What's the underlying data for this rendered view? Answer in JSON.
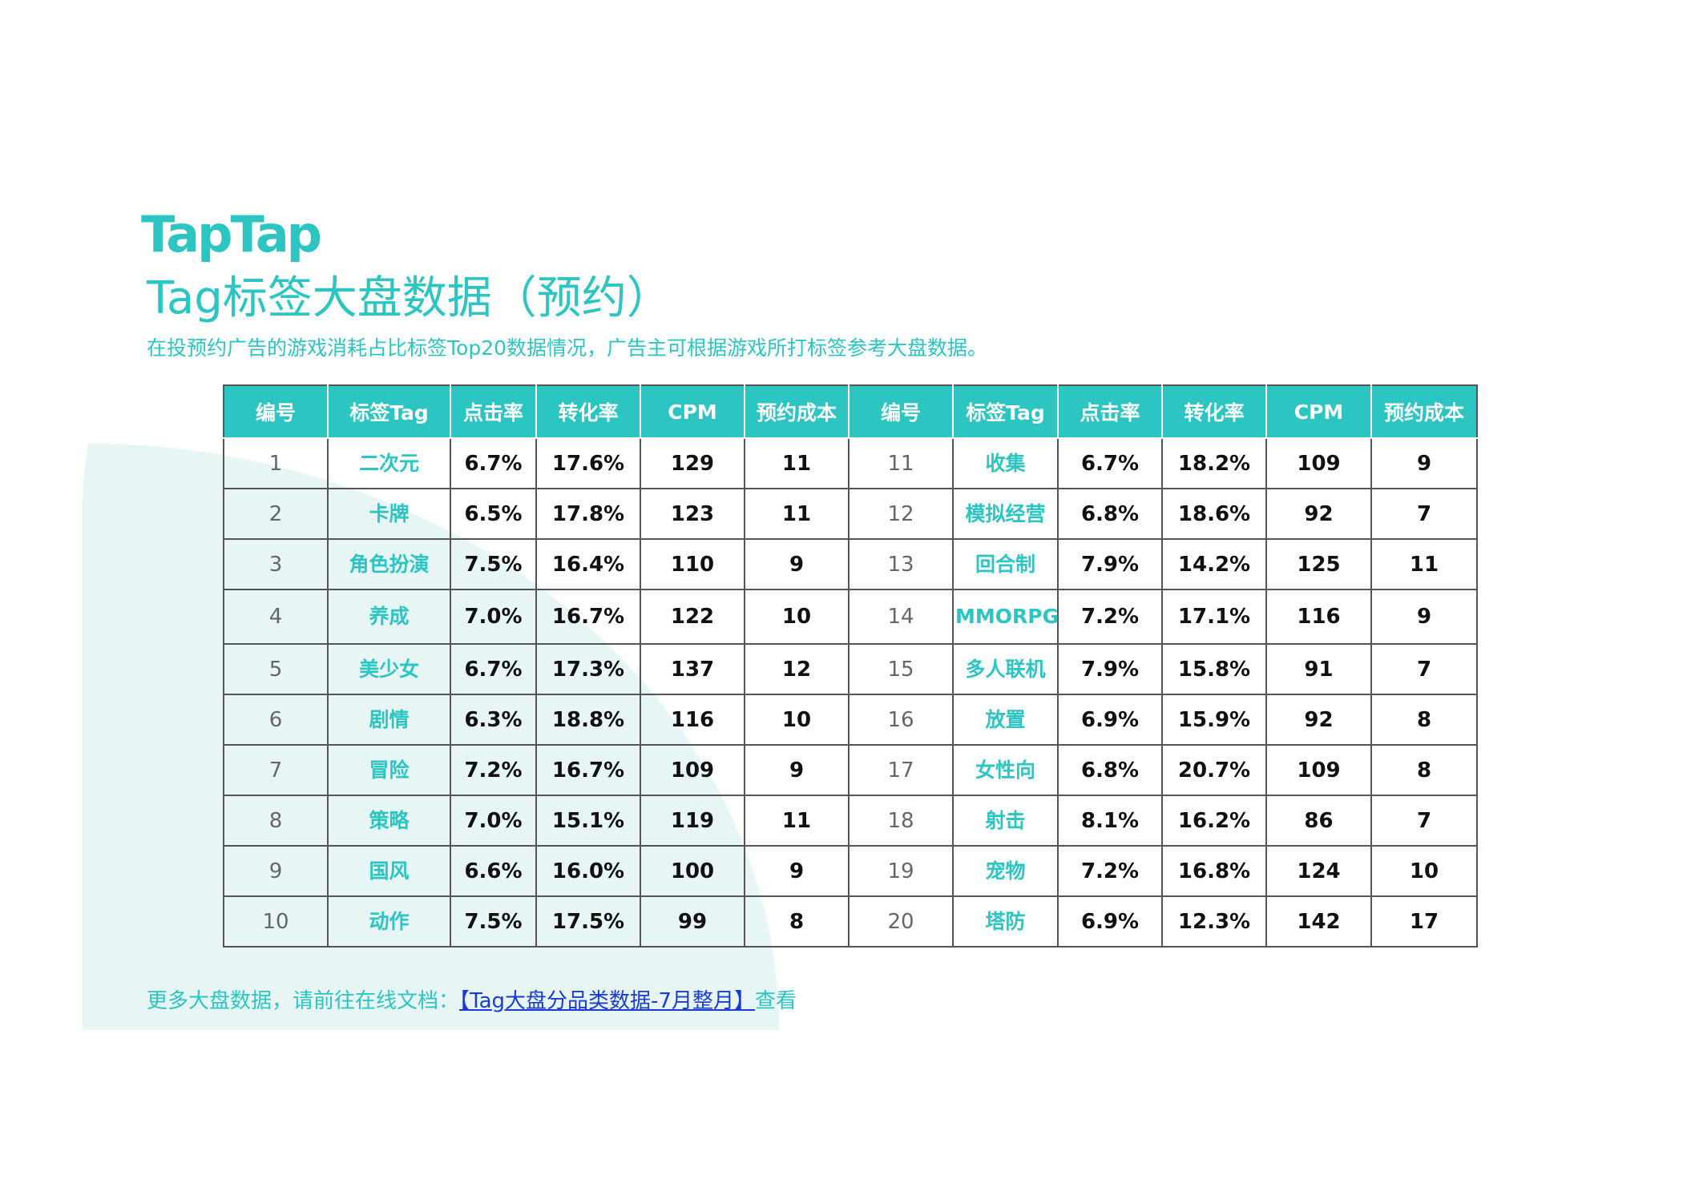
{
  "logo": "TapTap",
  "title": "Tag标签大盘数据（预约）",
  "subtitle": "在投预约广告的游戏消耗占比标签Top20数据情况，广告主可根据游戏所打标签参考大盘数据。",
  "table": {
    "headers": [
      "编号",
      "标签Tag",
      "点击率",
      "转化率",
      "CPM",
      "预约成本",
      "编号",
      "标签Tag",
      "点击率",
      "转化率",
      "CPM",
      "预约成本"
    ],
    "rows": [
      [
        "1",
        "二次元",
        "6.7%",
        "17.6%",
        "129",
        "11",
        "11",
        "收集",
        "6.7%",
        "18.2%",
        "109",
        "9"
      ],
      [
        "2",
        "卡牌",
        "6.5%",
        "17.8%",
        "123",
        "11",
        "12",
        "模拟经营",
        "6.8%",
        "18.6%",
        "92",
        "7"
      ],
      [
        "3",
        "角色扮演",
        "7.5%",
        "16.4%",
        "110",
        "9",
        "13",
        "回合制",
        "7.9%",
        "14.2%",
        "125",
        "11"
      ],
      [
        "4",
        "养成",
        "7.0%",
        "16.7%",
        "122",
        "10",
        "14",
        "MMORPG",
        "7.2%",
        "17.1%",
        "116",
        "9"
      ],
      [
        "5",
        "美少女",
        "6.7%",
        "17.3%",
        "137",
        "12",
        "15",
        "多人联机",
        "7.9%",
        "15.8%",
        "91",
        "7"
      ],
      [
        "6",
        "剧情",
        "6.3%",
        "18.8%",
        "116",
        "10",
        "16",
        "放置",
        "6.9%",
        "15.9%",
        "92",
        "8"
      ],
      [
        "7",
        "冒险",
        "7.2%",
        "16.7%",
        "109",
        "9",
        "17",
        "女性向",
        "6.8%",
        "20.7%",
        "109",
        "8"
      ],
      [
        "8",
        "策略",
        "7.0%",
        "15.1%",
        "119",
        "11",
        "18",
        "射击",
        "8.1%",
        "16.2%",
        "86",
        "7"
      ],
      [
        "9",
        "国风",
        "6.6%",
        "16.0%",
        "100",
        "9",
        "19",
        "宠物",
        "7.2%",
        "16.8%",
        "124",
        "10"
      ],
      [
        "10",
        "动作",
        "7.5%",
        "17.5%",
        "99",
        "8",
        "20",
        "塔防",
        "6.9%",
        "12.3%",
        "142",
        "17"
      ]
    ]
  },
  "footer": {
    "prefix": "更多大盘数据，请前往在线文档：",
    "link_text": "【Tag大盘分品类数据-7月整月】",
    "suffix": "查看"
  },
  "colors": {
    "accent": "#2cc5c1",
    "background_shape": "#e7f6f4",
    "link": "#1a3cd6"
  }
}
